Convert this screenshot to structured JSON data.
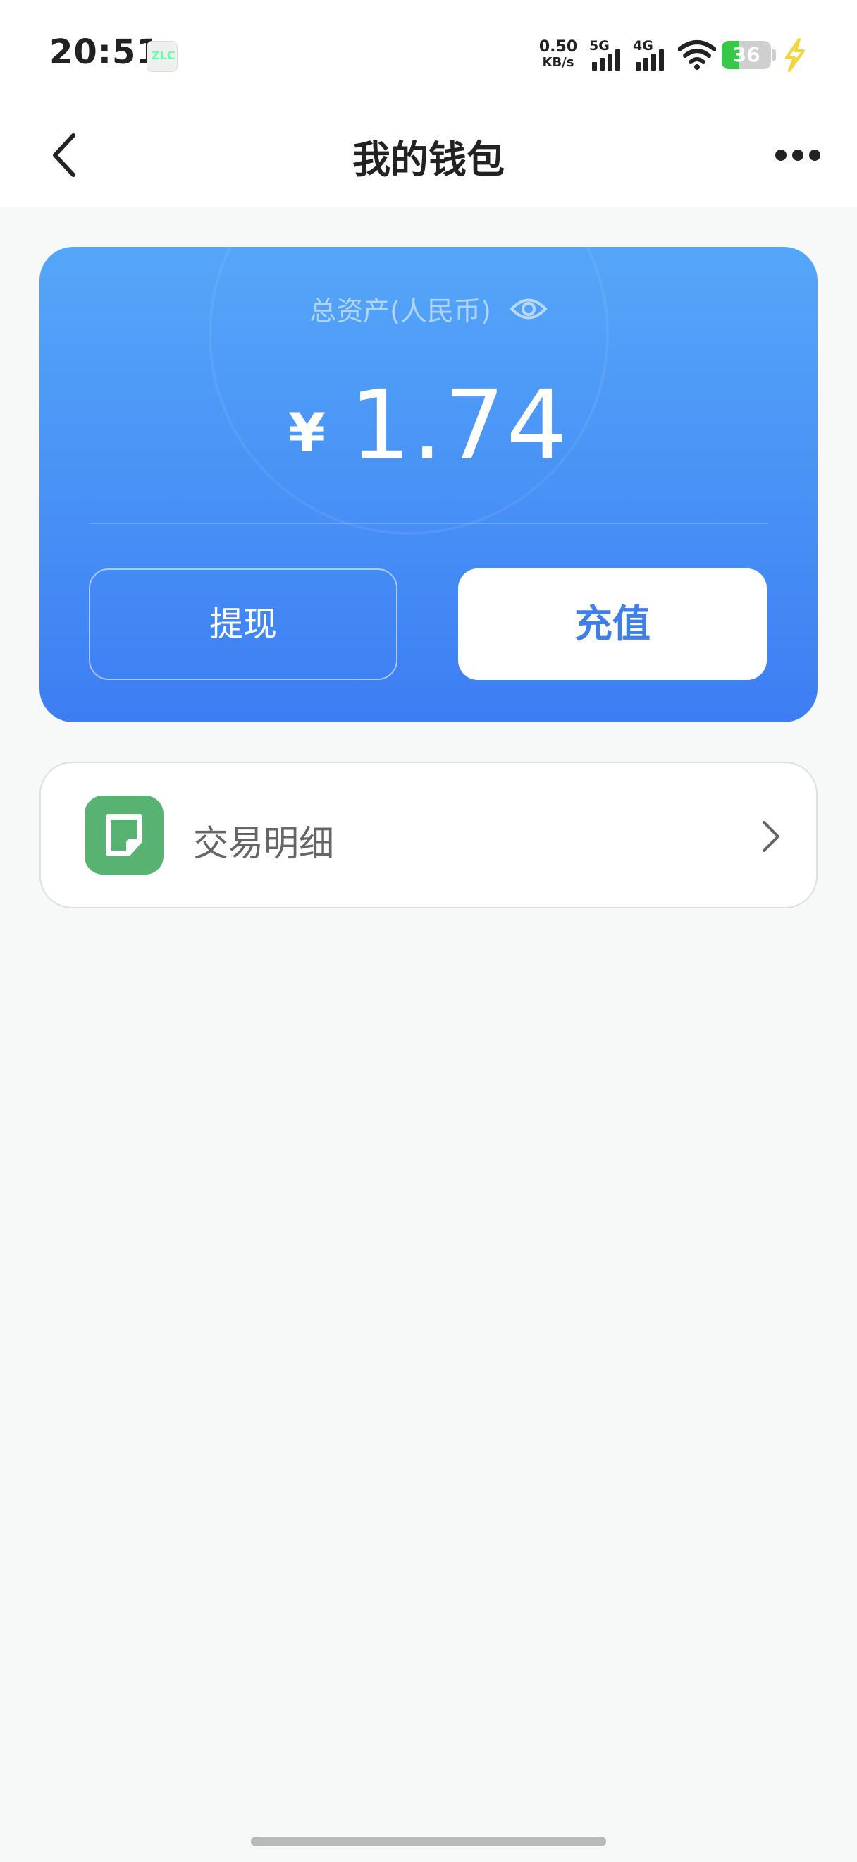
{
  "status_bar": {
    "time": "20:51",
    "net_speed_value": "0.50",
    "net_speed_unit": "KB/s",
    "signal_1_label": "5G",
    "signal_2_label": "4G",
    "battery_percent": "36",
    "battery_level": 0.36,
    "battery_color": "#37c847",
    "charging_icon_color": "#f4d43a"
  },
  "header": {
    "title": "我的钱包",
    "back_icon": "chevron-left-icon",
    "more_icon": "more-dots-icon"
  },
  "wallet": {
    "asset_label": "总资产(人民币)",
    "currency_symbol": "¥",
    "amount": "1.74",
    "withdraw_label": "提现",
    "recharge_label": "充值",
    "card_gradient_top": "#55a6f9",
    "card_gradient_bottom": "#3d7ef3",
    "recharge_text_color": "#3e7fea"
  },
  "transactions": {
    "label": "交易明细",
    "icon": "note-icon",
    "icon_color": "#58b373"
  }
}
